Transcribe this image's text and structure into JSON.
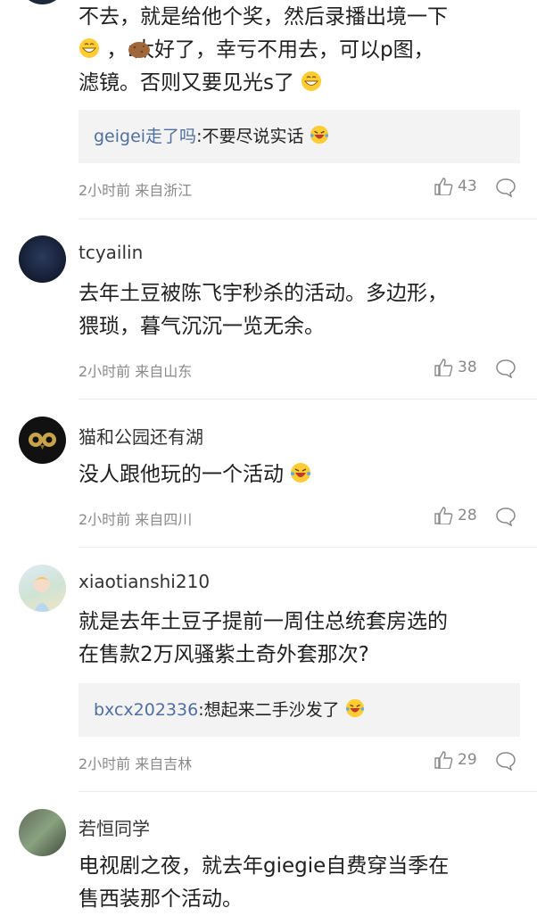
{
  "comments": [
    {
      "text_lines": [
        "不去，就是给他个奖，然后录播出境一下",
        "，:太好了，幸亏不用去，可以p图，",
        "滤镜。否则又要见光s了"
      ],
      "reply": {
        "user": "geigei走了吗",
        "text": ":不要尽说实话"
      },
      "meta": "2小时前 来自浙江",
      "likes": "43"
    },
    {
      "username": "tcyailin",
      "text_lines": [
        "去年土豆被陈飞宇秒杀的活动。多边形，",
        "猥琐，暮气沉沉一览无余。"
      ],
      "meta": "2小时前 来自山东",
      "likes": "38"
    },
    {
      "username": "猫和公园还有湖",
      "text_lines": [
        "没人跟他玩的一个活动"
      ],
      "meta": "2小时前 来自四川",
      "likes": "28"
    },
    {
      "username": "xiaotianshi210",
      "text_lines": [
        "就是去年土豆子提前一周住总统套房选的",
        "在售款2万风骚紫土奇外套那次?"
      ],
      "reply": {
        "user": "bxcx202336",
        "text": ":想起来二手沙发了"
      },
      "meta": "2小时前 来自吉林",
      "likes": "29"
    },
    {
      "username": "若恒同学",
      "text_lines": [
        "电视剧之夜，就去年giegie自费穿当季在",
        "售西装那个活动。"
      ]
    }
  ],
  "colors": {
    "reply_user": "#4f6fa0",
    "meta": "#8a8a8a",
    "reply_bg": "#f3f3f3"
  },
  "icons": [
    "grin-emoji",
    "potato-emoji",
    "laugh-cry-emoji",
    "thumbs-up-icon",
    "comment-bubble-icon"
  ]
}
